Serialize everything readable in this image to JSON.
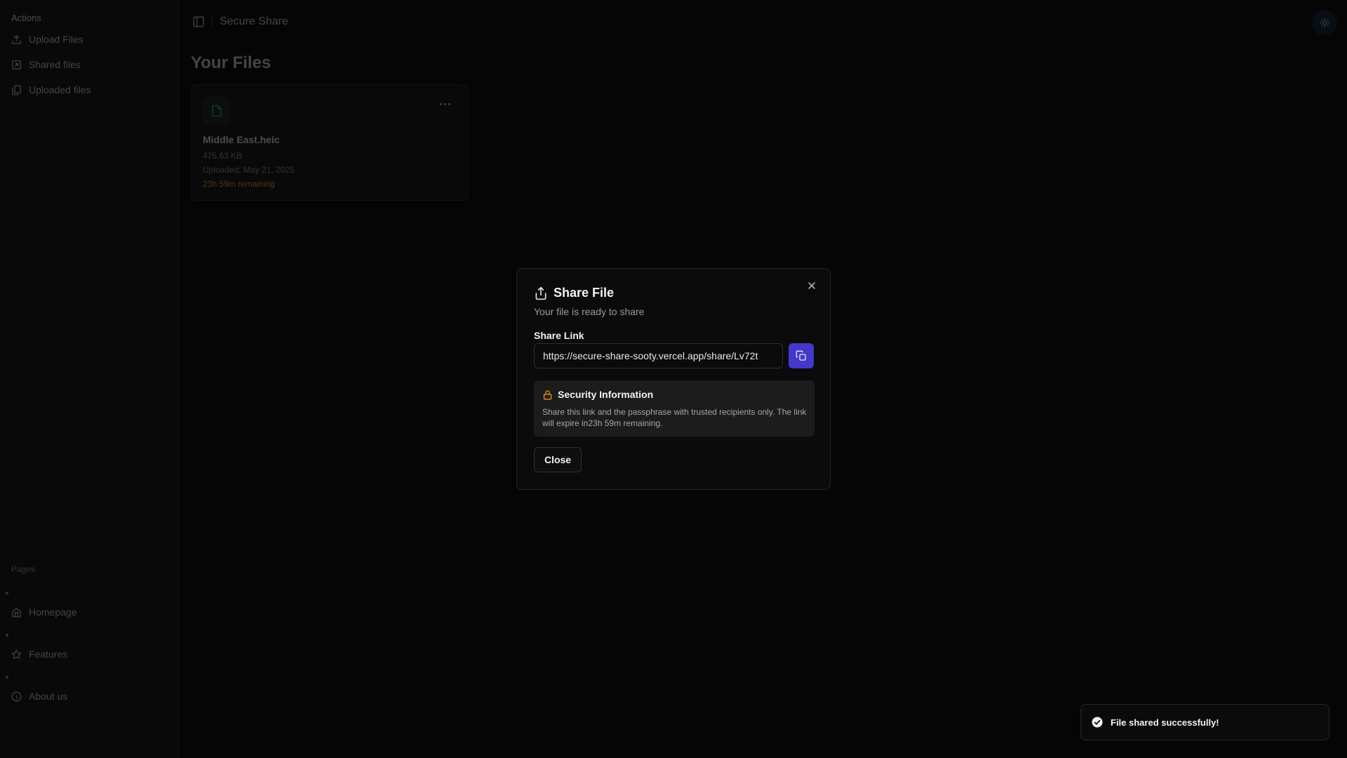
{
  "sidebar": {
    "actions_label": "Actions",
    "actions": [
      {
        "label": "Upload Files",
        "icon": "upload-icon"
      },
      {
        "label": "Shared files",
        "icon": "share-square-icon"
      },
      {
        "label": "Uploaded files",
        "icon": "files-icon"
      }
    ],
    "pages_label": "Pages",
    "pages": [
      {
        "label": "Homepage",
        "icon": "home-icon"
      },
      {
        "label": "Features",
        "icon": "star-icon"
      },
      {
        "label": "About us",
        "icon": "info-icon"
      }
    ]
  },
  "header": {
    "title": "Secure Share",
    "theme_icon": "sun-icon"
  },
  "main": {
    "title": "Your Files",
    "files": [
      {
        "name": "Middle East.heic",
        "size": "475.63 KB",
        "uploaded": "Uploaded: May 21, 2025",
        "remaining": "23h 59m remaining"
      }
    ]
  },
  "dialog": {
    "title": "Share File",
    "description": "Your file is ready to share",
    "link_label": "Share Link",
    "link_value": "https://secure-share-sooty.vercel.app/share/Lv72t",
    "security_title": "Security Information",
    "security_text": "Share this link and the passphrase with trusted recipients only. The link will expire in23h 59m remaining.",
    "close_label": "Close"
  },
  "toast": {
    "message": "File shared successfully!"
  },
  "colors": {
    "accent": "#4338ca",
    "warning": "#f59e0b",
    "remaining": "#a35a1a",
    "file_icon": "#1c6b46"
  }
}
